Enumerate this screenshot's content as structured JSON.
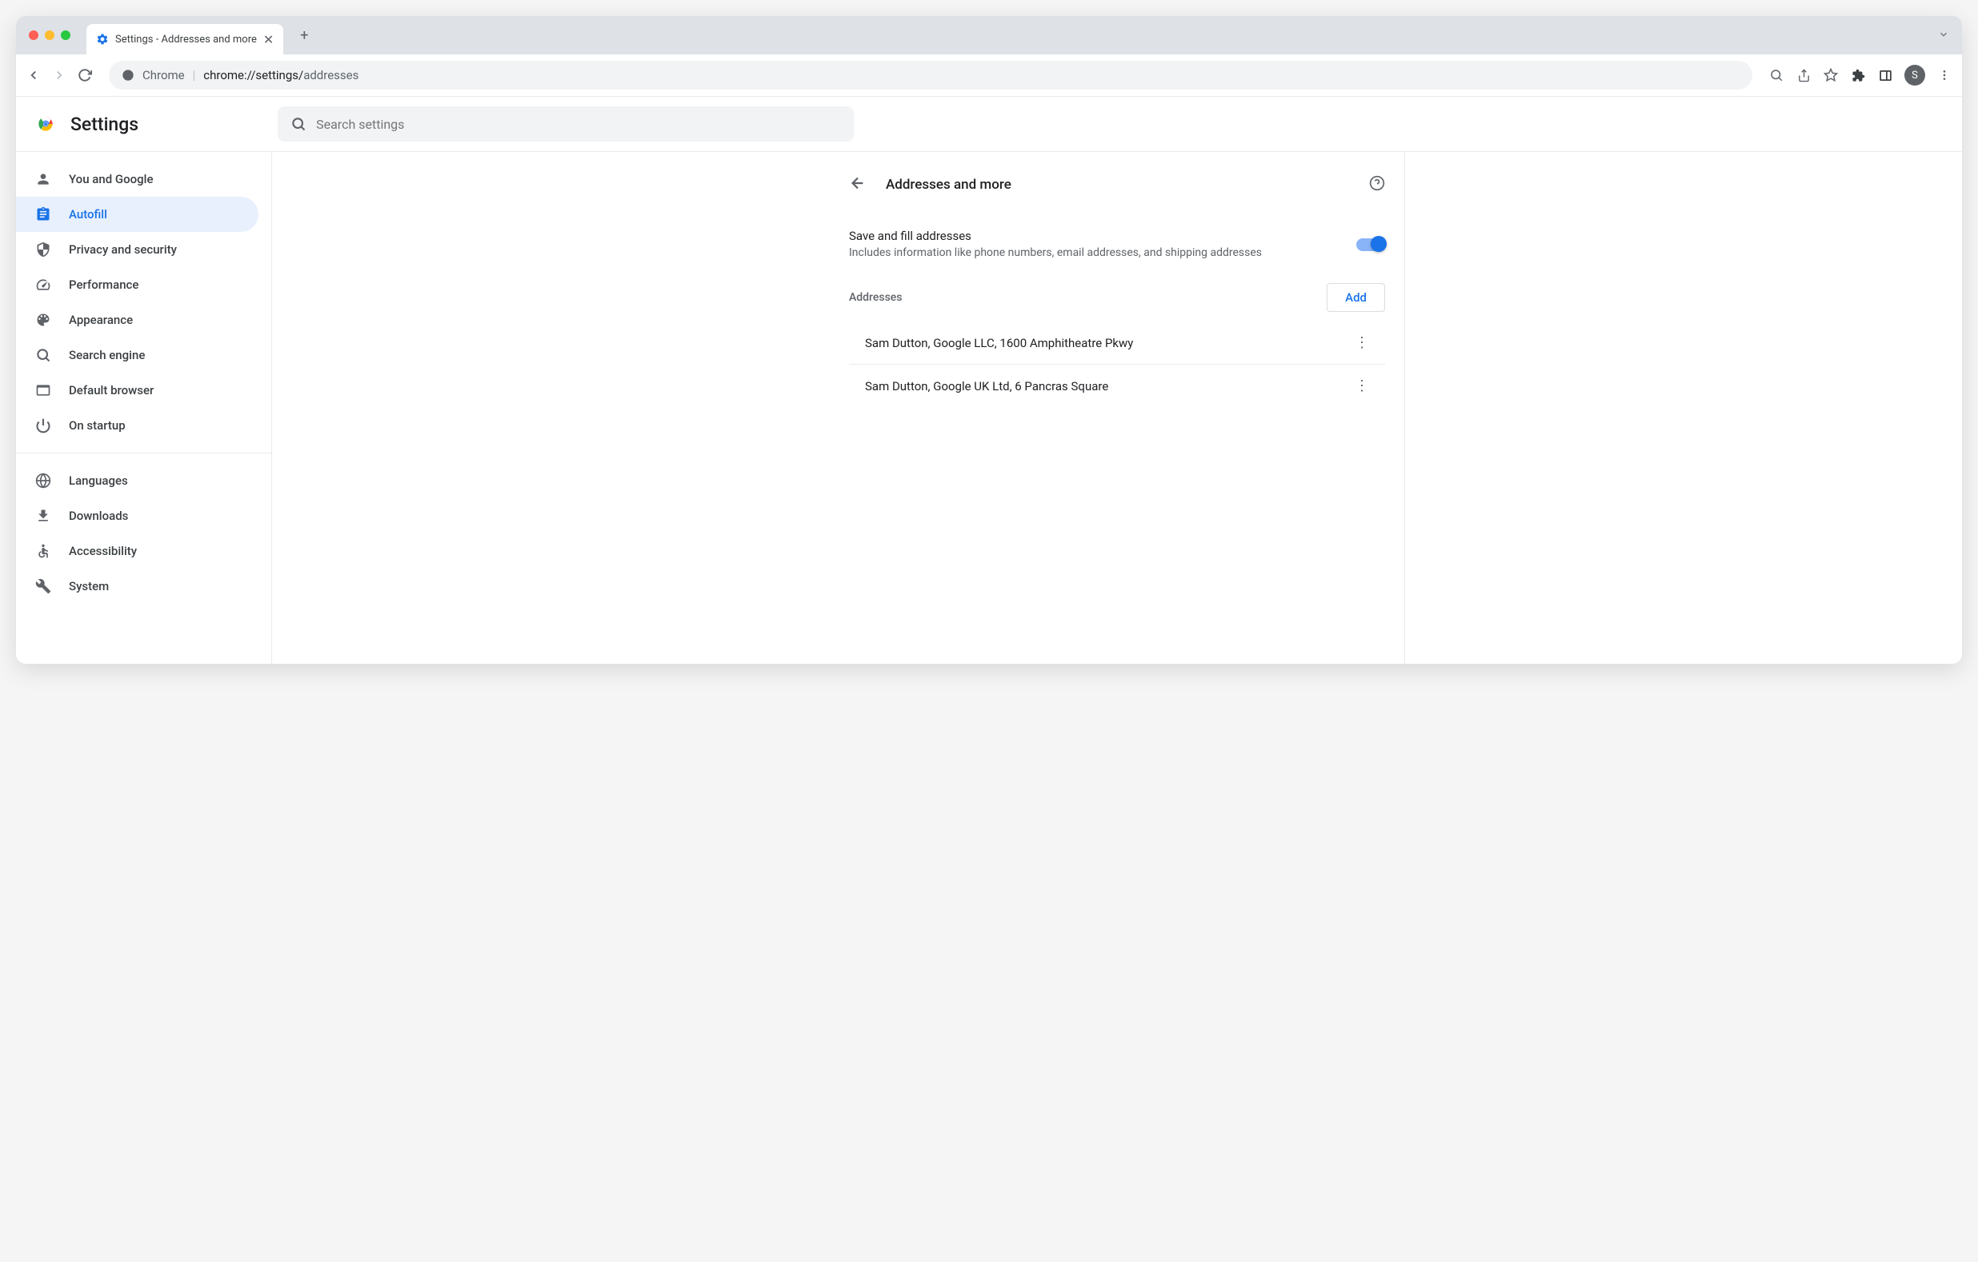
{
  "tab": {
    "title": "Settings - Addresses and more"
  },
  "address_bar": {
    "protocol": "Chrome",
    "path_dark": "chrome://",
    "path_mid": "settings/",
    "path_light": "addresses"
  },
  "avatar_letter": "S",
  "settings_title": "Settings",
  "search_placeholder": "Search settings",
  "sidebar": {
    "items": [
      {
        "label": "You and Google"
      },
      {
        "label": "Autofill"
      },
      {
        "label": "Privacy and security"
      },
      {
        "label": "Performance"
      },
      {
        "label": "Appearance"
      },
      {
        "label": "Search engine"
      },
      {
        "label": "Default browser"
      },
      {
        "label": "On startup"
      }
    ],
    "items2": [
      {
        "label": "Languages"
      },
      {
        "label": "Downloads"
      },
      {
        "label": "Accessibility"
      },
      {
        "label": "System"
      }
    ]
  },
  "page": {
    "title": "Addresses and more",
    "toggle": {
      "title": "Save and fill addresses",
      "subtitle": "Includes information like phone numbers, email addresses, and shipping addresses"
    },
    "section_label": "Addresses",
    "add_label": "Add",
    "addresses": [
      "Sam Dutton, Google LLC, 1600 Amphitheatre Pkwy",
      "Sam Dutton, Google UK Ltd, 6 Pancras Square"
    ]
  }
}
